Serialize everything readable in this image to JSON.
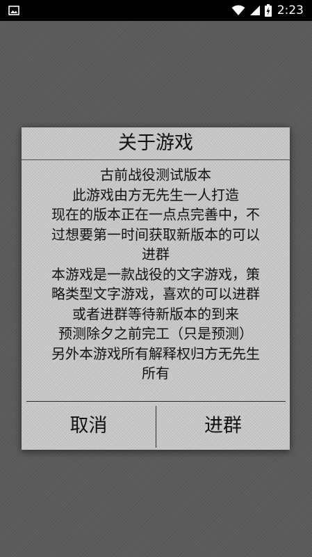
{
  "status_bar": {
    "time": "2:23",
    "icons": {
      "left": "gallery-icon",
      "right": [
        "wifi-icon",
        "signal-icon",
        "battery-charging-icon"
      ]
    }
  },
  "dialog": {
    "title": "关于游戏",
    "message_lines": [
      "古前战役测试版本",
      "此游戏由方无先生一人打造",
      "现在的版本正在一点点完善中，不",
      "过想要第一时间获取新版本的可以",
      "进群",
      "本游戏是一款战役的文字游戏，策",
      "略类型文字游戏，喜欢的可以进群",
      "或者进群等待新版本的到来",
      "预测除夕之前完工（只是预测）",
      "另外本游戏所有解释权归方无先生",
      "所有"
    ],
    "buttons": {
      "negative": "取消",
      "positive": "进群"
    }
  },
  "colors": {
    "background": "#5a5a5a",
    "dialog_background": "#c8c8c8",
    "text": "#111111",
    "status_bar": "#000000"
  }
}
